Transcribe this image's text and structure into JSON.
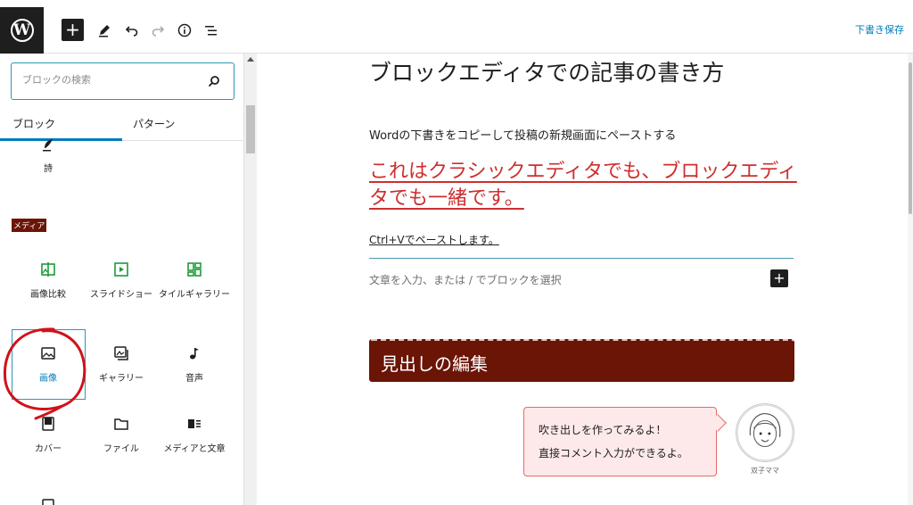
{
  "topbar": {
    "logo": "W",
    "add_label": "+",
    "save_draft": "下書き保存",
    "icons": [
      "wordpress-logo",
      "add",
      "pencil",
      "undo",
      "redo",
      "info",
      "list-outline"
    ]
  },
  "sidebar": {
    "search": {
      "placeholder": "ブロックの検索"
    },
    "tabs": [
      {
        "label": "ブロック",
        "active": true
      },
      {
        "label": "パターン",
        "active": false
      }
    ],
    "blocks_top": [
      {
        "label": "詩",
        "icon": "poem-icon"
      }
    ],
    "category_label": "メディア",
    "media_blocks": [
      {
        "label": "画像比較",
        "icon": "image-compare-icon",
        "color": "#1e9b3a"
      },
      {
        "label": "スライドショー",
        "icon": "slideshow-icon",
        "color": "#1e9b3a"
      },
      {
        "label": "タイルギャラリー",
        "icon": "tiled-gallery-icon",
        "color": "#1e9b3a"
      },
      {
        "label": "画像",
        "icon": "image-icon",
        "selected": true
      },
      {
        "label": "ギャラリー",
        "icon": "gallery-icon"
      },
      {
        "label": "音声",
        "icon": "audio-icon"
      },
      {
        "label": "カバー",
        "icon": "cover-icon"
      },
      {
        "label": "ファイル",
        "icon": "file-icon"
      },
      {
        "label": "メディアと文章",
        "icon": "media-text-icon"
      }
    ]
  },
  "editor": {
    "title": "ブロックエディタでの記事の書き方",
    "paragraph": "Wordの下書きをコピーして投稿の新規画面にペーストする",
    "link_paragraph": "これはクラシックエディタでも、ブロックエディタでも一緒です。",
    "ctrl_paragraph": "Ctrl+Vでペーストします。",
    "placeholder": "文章を入力、または / でブロックを選択",
    "inline_add": "+",
    "heading": "見出しの編集",
    "balloon": {
      "line1": "吹き出しを作ってみるよ！",
      "line2": "直接コメント入力ができるよ。"
    },
    "avatar_name": "双子ママ"
  },
  "colors": {
    "accent": "#007cba",
    "heading_bg": "#6b1506",
    "link_red": "#cf2e2e",
    "balloon_bg": "#fde9e9",
    "balloon_border": "#e86a6a"
  }
}
